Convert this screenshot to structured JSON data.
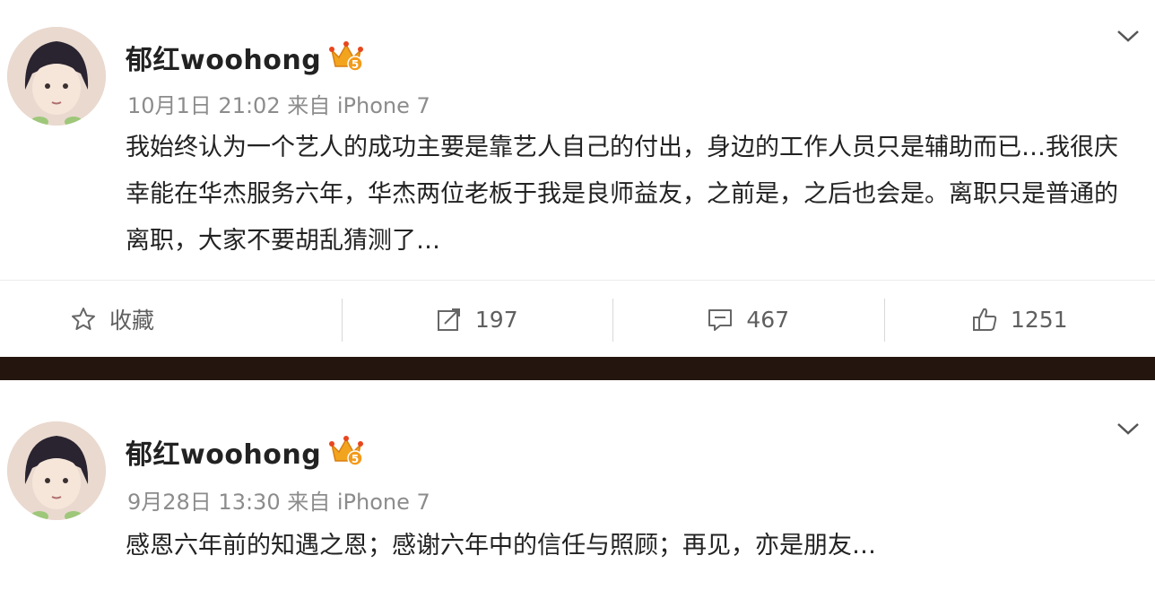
{
  "posts": [
    {
      "author": "郁红woohong",
      "meta": "10月1日 21:02 来自 iPhone 7",
      "content": "我始终认为一个艺人的成功主要是靠艺人自己的付出，身边的工作人员只是辅助而已…我很庆幸能在华杰服务六年，华杰两位老板于我是良师益友，之前是，之后也会是。离职只是普通的离职，大家不要胡乱猜测了…",
      "actions": {
        "favorite_label": "收藏",
        "repost_count": "197",
        "comment_count": "467",
        "like_count": "1251"
      }
    },
    {
      "author": "郁红woohong",
      "meta": "9月28日 13:30 来自 iPhone 7",
      "content": "感恩六年前的知遇之恩；感谢六年中的信任与照顾；再见，亦是朋友…"
    }
  ],
  "icons": {
    "favorite": "star-icon",
    "repost": "repost-icon",
    "comment": "comment-icon",
    "like": "thumbs-up-icon",
    "menu": "chevron-down-icon",
    "badge": "vip-crown-icon"
  },
  "colors": {
    "divider": "#24150f",
    "badge": "#f0a020"
  }
}
